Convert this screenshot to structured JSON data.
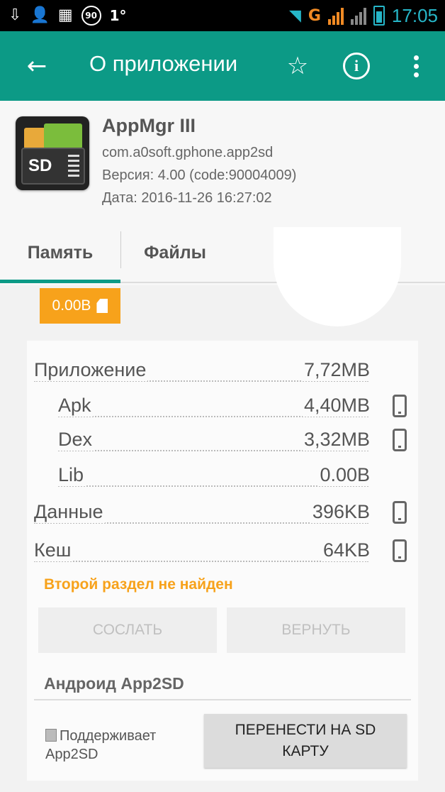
{
  "status_bar": {
    "left_icons": [
      "download-icon",
      "person-icon",
      "image-icon",
      "badge-90-icon"
    ],
    "badge_text": "90",
    "temperature": "1°",
    "network_type": "G",
    "time": "17:05",
    "accent_color": "#26b6c8"
  },
  "app_bar": {
    "title": "О приложении",
    "color": "#0c9a86"
  },
  "app": {
    "name": "AppMgr III",
    "package": "com.a0soft.gphone.app2sd",
    "version": "Версия: 4.00 (code:90004009)",
    "date": "Дата: 2016-11-26 16:27:02",
    "icon_text": "SD"
  },
  "tabs": [
    {
      "label": "Память",
      "active": true
    },
    {
      "label": "Файлы",
      "active": false
    }
  ],
  "storage_badge": {
    "value": "0.00B",
    "color": "#f7a21b"
  },
  "memory": {
    "rows": [
      {
        "label": "Приложение",
        "value": "7,72MB",
        "phone_icon": false,
        "indent": false
      },
      {
        "label": "Apk",
        "value": "4,40MB",
        "phone_icon": true,
        "indent": true
      },
      {
        "label": "Dex",
        "value": "3,32MB",
        "phone_icon": true,
        "indent": true
      },
      {
        "label": "Lib",
        "value": "0.00B",
        "phone_icon": false,
        "indent": true
      },
      {
        "label": "Данные",
        "value": "396KB",
        "phone_icon": true,
        "indent": false
      },
      {
        "label": "Кеш",
        "value": "64KB",
        "phone_icon": true,
        "indent": false
      }
    ],
    "warning": "Второй раздел не найден",
    "send_button": "СОСЛАТЬ",
    "return_button": "ВЕРНУТЬ"
  },
  "app2sd": {
    "heading": "Андроид App2SD",
    "support_text": "Поддерживает App2SD",
    "move_button": "ПЕРЕНЕСТИ НА SD КАРТУ"
  }
}
